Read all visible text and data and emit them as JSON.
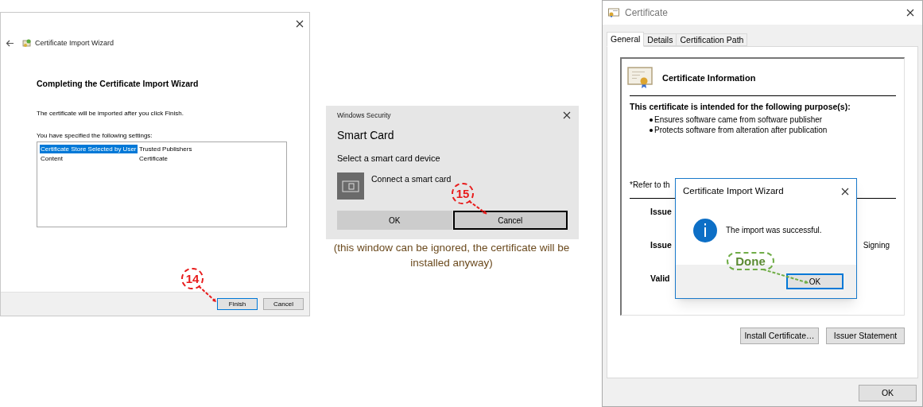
{
  "wizard_window": {
    "title": "Certificate Import Wizard",
    "heading": "Completing the Certificate Import Wizard",
    "message": "The certificate will be imported after you click Finish.",
    "settings_label": "You have specified the following settings:",
    "settings": [
      {
        "name": "Certificate Store Selected by User",
        "value": "Trusted Publishers",
        "selected": true
      },
      {
        "name": "Content",
        "value": "Certificate",
        "selected": false
      }
    ],
    "buttons": [
      {
        "label": "Finish",
        "default": true
      },
      {
        "label": "Cancel",
        "default": false
      }
    ]
  },
  "smart_card_dialog": {
    "caption": "Windows Security",
    "title": "Smart Card",
    "prompt": "Select a smart card device",
    "device": "Connect a smart card",
    "buttons": [
      {
        "label": "OK",
        "focused": false
      },
      {
        "label": "Cancel",
        "focused": true
      }
    ]
  },
  "note": "(this window can be ignored, the certificate will be installed anyway)",
  "certificate_window": {
    "title": "Certificate",
    "tabs": [
      {
        "label": "General",
        "selected": true
      },
      {
        "label": "Details",
        "selected": false
      },
      {
        "label": "Certification Path",
        "selected": false
      }
    ],
    "info_title": "Certificate Information",
    "purpose_heading": "This certificate is intended for the following purpose(s):",
    "purposes": [
      "Ensures software came from software publisher",
      "Protects software from alteration after publication"
    ],
    "refer_note": "*Refer to th",
    "fields": [
      {
        "label": "Issue"
      },
      {
        "label": "Issue",
        "value": "Signing"
      },
      {
        "label": "Valid"
      }
    ],
    "buttons": [
      "Install Certificate…",
      "Issuer Statement"
    ],
    "ok_button": "OK"
  },
  "import_dialog": {
    "title": "Certificate Import Wizard",
    "message": "The import was successful.",
    "button": "OK"
  },
  "callouts": [
    {
      "label": "14",
      "color": "#e81c1c"
    },
    {
      "label": "15",
      "color": "#e81c1c"
    },
    {
      "label": "Done",
      "color": "#70ad47"
    }
  ]
}
